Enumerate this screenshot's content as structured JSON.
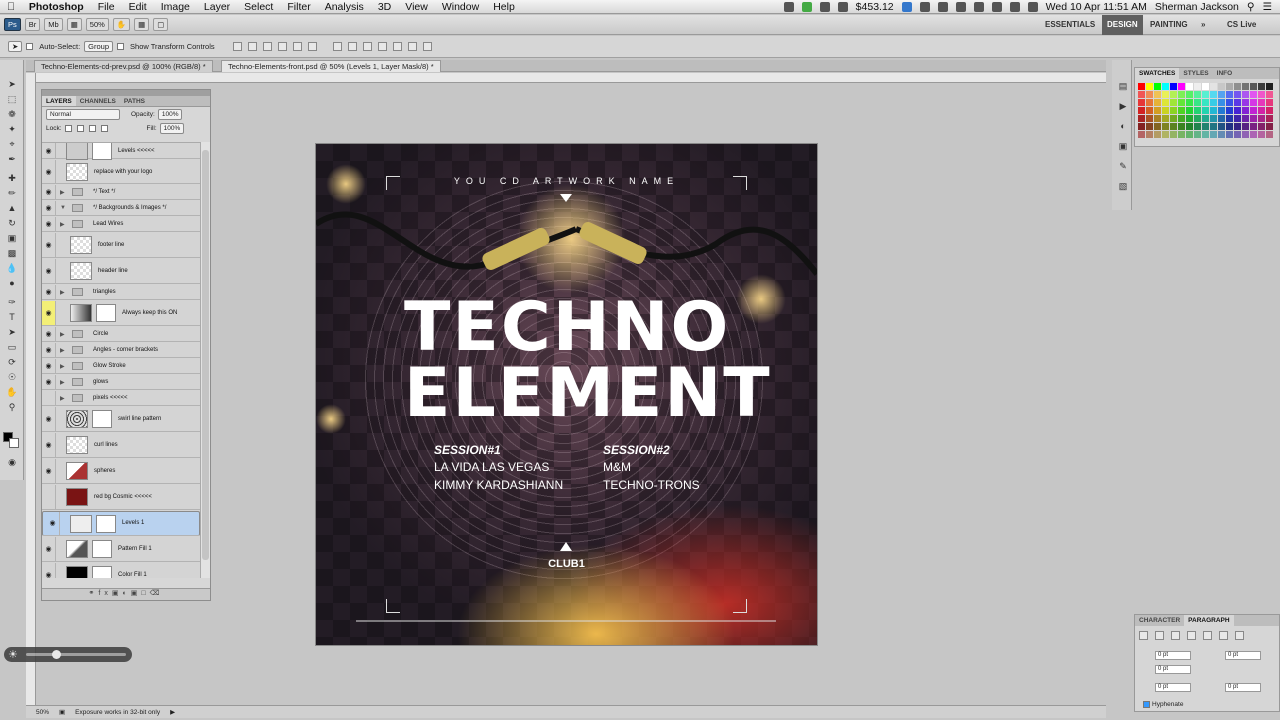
{
  "menubar": {
    "apple": "",
    "app": "Photoshop",
    "items": [
      "File",
      "Edit",
      "Image",
      "Layer",
      "Select",
      "Filter",
      "Analysis",
      "3D",
      "View",
      "Window",
      "Help"
    ],
    "price": "$453.12",
    "datetime": "Wed 10 Apr  11:51 AM",
    "user": "Sherman Jackson"
  },
  "workspace": {
    "zoom": "50%",
    "essentials": "ESSENTIALS",
    "design": "DESIGN",
    "painting": "PAINTING",
    "more": "»",
    "cslive": "CS Live"
  },
  "options": {
    "auto_select": "Auto-Select:",
    "group": "Group",
    "show_transform": "Show Transform Controls"
  },
  "doc_tabs": [
    "Techno-Elements-cd-prev.psd @ 100% (RGB/8) *",
    "Techno-Elements-front.psd @ 50% (Levels 1, Layer Mask/8) *"
  ],
  "layers_panel": {
    "tabs": [
      "LAYERS",
      "CHANNELS",
      "PATHS"
    ],
    "blend_mode": "Normal",
    "opacity_label": "Opacity:",
    "opacity": "100%",
    "lock_label": "Lock:",
    "fill_label": "Fill:",
    "fill": "100%",
    "layers": [
      "Levels <<<<<",
      "replace with your logo",
      "*/ Text */",
      "*/ Backgrounds & Images */",
      "Lead Wires",
      "footer line",
      "header line",
      "triangles",
      "Always keep this ON",
      "Circle",
      "Angles - corner brackets",
      "Glow Stroke",
      "glows",
      "pixels <<<<<",
      "swirl line pattern",
      "curl lines",
      "spheres",
      "red bg Cosmic <<<<<",
      "Levels 1",
      "Pattern Fill 1",
      "Color Fill 1"
    ]
  },
  "artwork": {
    "header": "YOU CD ARTWORK NAME",
    "title1": "TECHNO",
    "title2": "ELEMENT",
    "session1": {
      "title": "SESSION#1",
      "line1": "LA VIDA LAS VEGAS",
      "line2": "KIMMY KARDASHIANN"
    },
    "session2": {
      "title": "SESSION#2",
      "line1": "M&M",
      "line2": "TECHNO-TRONS"
    },
    "club": "CLUB1"
  },
  "right_panels": {
    "swatch_tabs": [
      "SWATCHES",
      "STYLES",
      "INFO"
    ],
    "char_tabs": [
      "CHARACTER",
      "PARAGRAPH"
    ],
    "pt_values": [
      "0 pt",
      "0 pt",
      "0 pt",
      "0 pt",
      "0 pt"
    ],
    "hyphenate": "Hyphenate"
  },
  "status": {
    "zoom": "50%",
    "message": "Exposure works in 32-bit only"
  },
  "colors": {
    "accent_design": "#5f5f5f",
    "selected_layer": "#b9d2ef",
    "highlight_eye": "#f3ef77"
  }
}
